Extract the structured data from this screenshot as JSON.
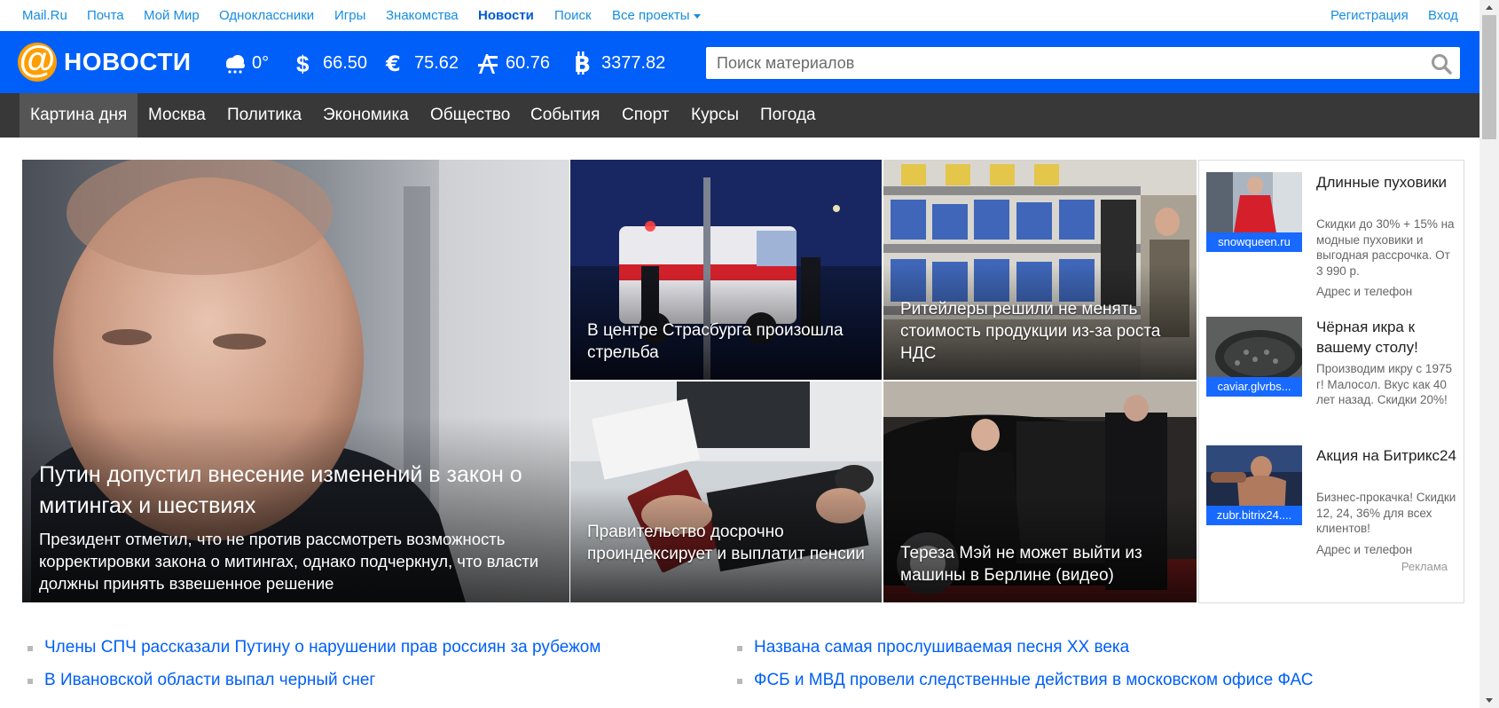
{
  "portal_nav": {
    "links": [
      "Mail.Ru",
      "Почта",
      "Мой Мир",
      "Одноклассники",
      "Игры",
      "Знакомства",
      "Новости",
      "Поиск",
      "Все проекты"
    ],
    "active": "Новости",
    "right_links": [
      "Регистрация",
      "Вход"
    ]
  },
  "header": {
    "logo_text": "НОВОСТИ",
    "weather": "0°",
    "usd": "66.50",
    "eur": "75.62",
    "oil": "60.76",
    "btc": "3377.82",
    "search_placeholder": "Поиск материалов"
  },
  "main_nav": {
    "items": [
      "Картина дня",
      "Москва",
      "Политика",
      "Экономика",
      "Общество",
      "События",
      "Спорт",
      "Курсы",
      "Погода"
    ],
    "active": "Картина дня"
  },
  "hero": {
    "title": "Путин допустил внесение изменений в закон о митингах и шествиях",
    "lead": "Президент отметил, что не против рассмотреть возможность корректировки закона о митингах, однако подчеркнул, что власти должны принять взвешенное решение"
  },
  "tiles": [
    {
      "title": "В центре Страсбурга произошла стрельба"
    },
    {
      "title": "Ритейлеры решили не менять стоимость продукции из-за роста НДС"
    },
    {
      "title": "Правительство досрочно проиндексирует и выплатит пенсии"
    },
    {
      "title": "Тереза Мэй не может выйти из машины в Берлине (видео)"
    }
  ],
  "ads": {
    "items": [
      {
        "domain": "snowqueen.ru",
        "title": "Длинные пуховики",
        "text": "Скидки до 30% + 15% на модные пуховики и выгодная рассрочка. От 3 990 р.",
        "link": "Адрес и телефон"
      },
      {
        "domain": "caviar.glvrbs...",
        "title": "Чёрная икра к вашему столу!",
        "text": "Производим икру с 1975 г! Малосол. Вкус как 40 лет назад. Скидки 20%!",
        "link": ""
      },
      {
        "domain": "zubr.bitrix24....",
        "title": "Акция на Битрикс24",
        "text": "Бизнес-прокачка! Скидки 12, 24, 36% для всех клиентов!",
        "link": "Адрес и телефон"
      }
    ],
    "label": "Реклама"
  },
  "news_list": {
    "left": [
      "Члены СПЧ рассказали Путину о нарушении прав россиян за рубежом",
      "В Ивановской области выпал черный снег"
    ],
    "right": [
      "Названа самая прослушиваемая песня XX века",
      "ФСБ и МВД провели следственные действия в московском офисе ФАС"
    ]
  },
  "colors": {
    "header_blue": "#005ff9",
    "nav_dark": "#383838",
    "link_blue": "#005ff9",
    "logo_orange": "#ff9e00",
    "ad_label_blue": "#1769ff"
  }
}
